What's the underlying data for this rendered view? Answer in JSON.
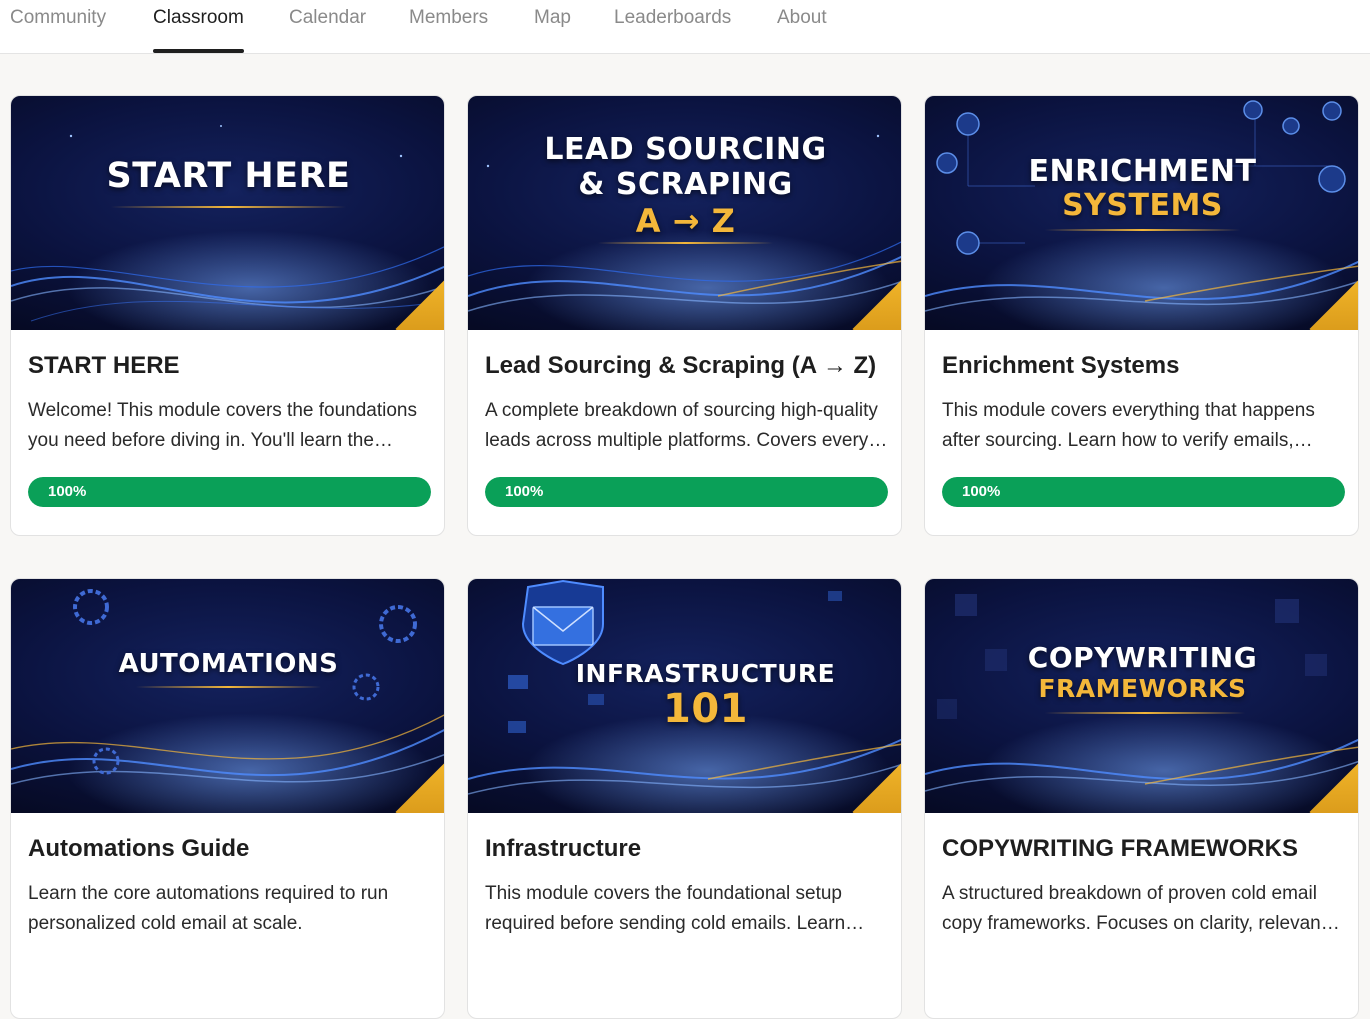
{
  "nav": {
    "tabs": [
      {
        "label": "Community"
      },
      {
        "label": "Classroom",
        "active": true
      },
      {
        "label": "Calendar"
      },
      {
        "label": "Members"
      },
      {
        "label": "Map"
      },
      {
        "label": "Leaderboards"
      },
      {
        "label": "About"
      }
    ]
  },
  "courses": [
    {
      "banner_lines": [
        "START HERE"
      ],
      "title": "START HERE",
      "description": "Welcome! This module covers the foundations you need before diving in. You'll learn the essentials.",
      "progress": 1.0,
      "progress_label": "100%"
    },
    {
      "banner_lines": [
        "LEAD SOURCING",
        "& SCRAPING",
        "A",
        "Z"
      ],
      "title": "Lead Sourcing & Scraping (A → Z)",
      "description": "A complete breakdown of sourcing high-quality leads across multiple platforms. Covers every major source.",
      "progress": 1.0,
      "progress_label": "100%"
    },
    {
      "banner_lines": [
        "ENRICHMENT",
        "SYSTEMS"
      ],
      "title": "Enrichment Systems",
      "description": "This module covers everything that happens after sourcing. Learn how to verify emails, enrich data and more.",
      "progress": 1.0,
      "progress_label": "100%"
    },
    {
      "banner_lines": [
        "AUTOMATIONS"
      ],
      "title": "Automations Guide",
      "description": "Learn the core automations required to run personalized cold email at scale."
    },
    {
      "banner_lines": [
        "INFRASTRUCTURE",
        "101"
      ],
      "title": "Infrastructure",
      "description": "This module covers the foundational setup required before sending cold emails. Learn domains, inboxes and more."
    },
    {
      "banner_lines": [
        "COPYWRITING",
        "FRAMEWORKS"
      ],
      "title": "COPYWRITING FRAMEWORKS",
      "description": "A structured breakdown of proven cold email copy frameworks. Focuses on clarity, relevance and results."
    }
  ],
  "colors": {
    "progress_fill": "#0aa058",
    "banner_gold": "#f4b73a",
    "banner_navy": "#0b1340"
  }
}
